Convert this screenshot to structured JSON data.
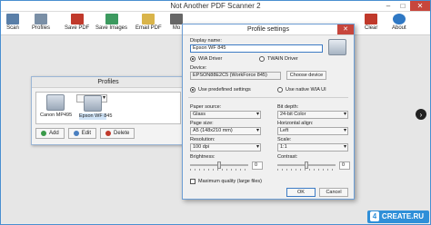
{
  "app": {
    "title": "Not Another PDF Scanner 2"
  },
  "window_controls": {
    "minimize": "–",
    "maximize": "□",
    "close": "✕"
  },
  "toolbar": {
    "items": [
      {
        "label": "Scan",
        "icon": "scan-icon",
        "color": "#5a7fa8"
      },
      {
        "label": "Profiles",
        "icon": "profiles-icon",
        "color": "#7a8fa6"
      },
      {
        "label": "Save PDF",
        "icon": "pdf-icon",
        "color": "#c0392b"
      },
      {
        "label": "Save Images",
        "icon": "images-icon",
        "color": "#3c9a5f"
      },
      {
        "label": "Email PDF",
        "icon": "email-icon",
        "color": "#d9b44a"
      },
      {
        "label": "Mo",
        "icon": "more-icon",
        "color": "#666666"
      },
      {
        "label": "Clear",
        "icon": "clear-icon",
        "color": "#c0392b"
      },
      {
        "label": "About",
        "icon": "about-icon",
        "color": "#2f78c4"
      }
    ]
  },
  "profiles_window": {
    "title": "Profiles",
    "items": [
      {
        "label": "Canon MP495",
        "selected": false
      },
      {
        "label": "Epson WF 845",
        "selected": true
      }
    ],
    "buttons": {
      "add": "Add",
      "edit": "Edit",
      "delete": "Delete"
    }
  },
  "profile_settings": {
    "title": "Profile settings",
    "close": "✕",
    "display_name_label": "Display name:",
    "display_name_value": "Epson WF 845",
    "driver_wia": "WIA Driver",
    "driver_twain": "TWAIN Driver",
    "device_label": "Device:",
    "device_value": "EPSON88E2C5 (WorkForce 845)",
    "choose_device": "Choose device",
    "use_predefined": "Use predefined settings",
    "use_native": "Use native WIA UI",
    "paper_source_label": "Paper source:",
    "paper_source_value": "Glass",
    "bit_depth_label": "Bit depth:",
    "bit_depth_value": "24-bit Color",
    "page_size_label": "Page size:",
    "page_size_value": "A5 (148x210 mm)",
    "horizontal_align_label": "Horizontal align:",
    "horizontal_align_value": "Left",
    "resolution_label": "Resolution:",
    "resolution_value": "100 dpi",
    "scale_label": "Scale:",
    "scale_value": "1:1",
    "brightness_label": "Brightness:",
    "brightness_value": "0",
    "contrast_label": "Contrast:",
    "contrast_value": "0",
    "max_quality": "Maximum quality (large files)",
    "ok": "OK",
    "cancel": "Cancel"
  },
  "nav": {
    "next_arrow": "›"
  },
  "watermark": {
    "text": "CREATE.RU"
  }
}
